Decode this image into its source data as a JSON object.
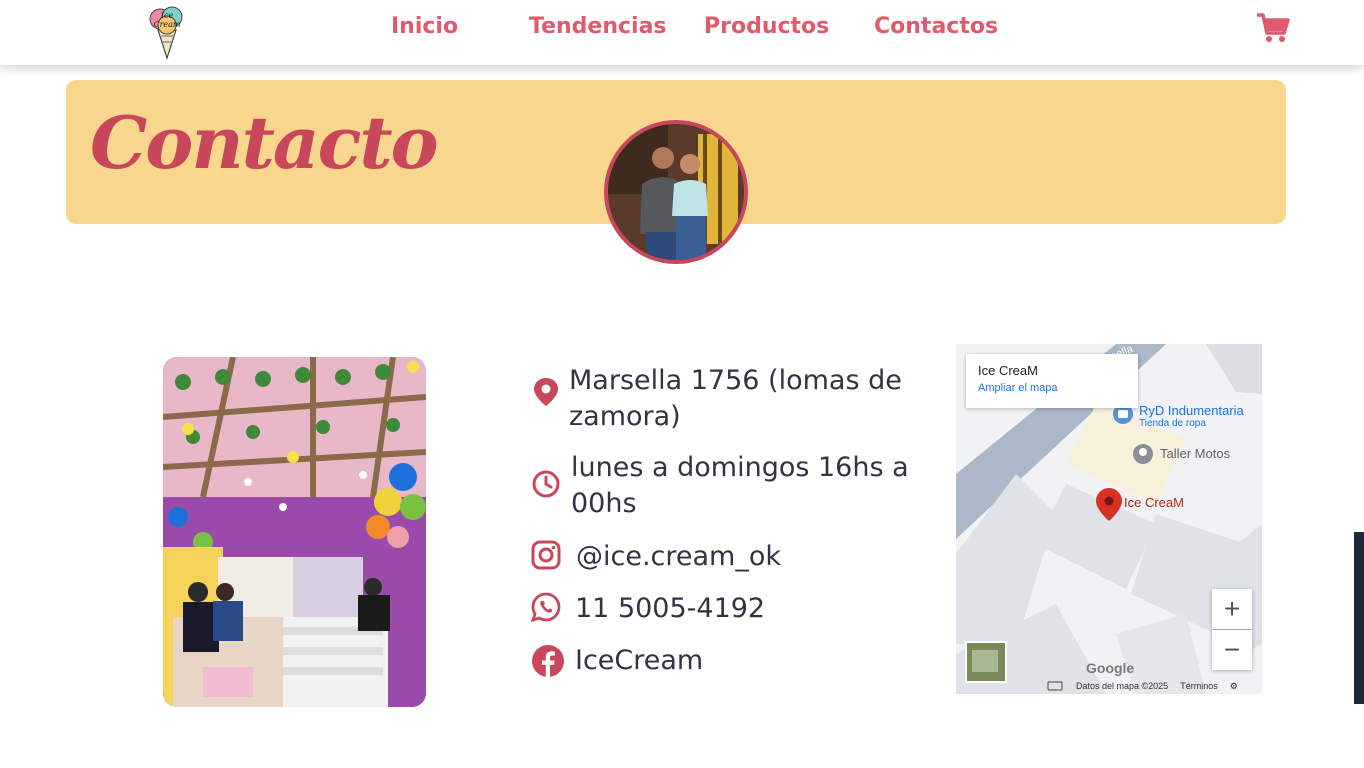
{
  "nav": {
    "links": [
      "Inicio",
      "Tendencias",
      "Productos",
      "Contactos"
    ],
    "logo_text": "Ice Cream"
  },
  "banner": {
    "title": "Contacto"
  },
  "contact": {
    "address_line1": "Marsella 1756 (lomas de",
    "address_line2": "zamora)",
    "hours_line1": "lunes a domingos 16hs a",
    "hours_line2": "00hs",
    "instagram": "@ice.cream_ok",
    "whatsapp": "11 5005-4192",
    "facebook": "IceCream"
  },
  "map": {
    "card_title": "Ice CreaM",
    "card_link": "Ampliar el mapa",
    "poi_store_name": "RyD Indumentaria",
    "poi_store_type": "Tienda de ropa",
    "poi_motos": "Taller Motos",
    "poi_main": "Ice CreaM",
    "zoom_in": "+",
    "zoom_out": "−",
    "google": "Google",
    "footer_data": "Datos del mapa ©2025",
    "footer_terms": "Términos"
  },
  "colors": {
    "accent": "#c9475b",
    "nav_link": "#e05a6e",
    "banner_bg": "#f9d68e",
    "text": "#2f3542"
  },
  "icons": [
    "shopping-cart-icon",
    "location-pin-icon",
    "clock-icon",
    "instagram-icon",
    "whatsapp-icon",
    "facebook-icon"
  ]
}
